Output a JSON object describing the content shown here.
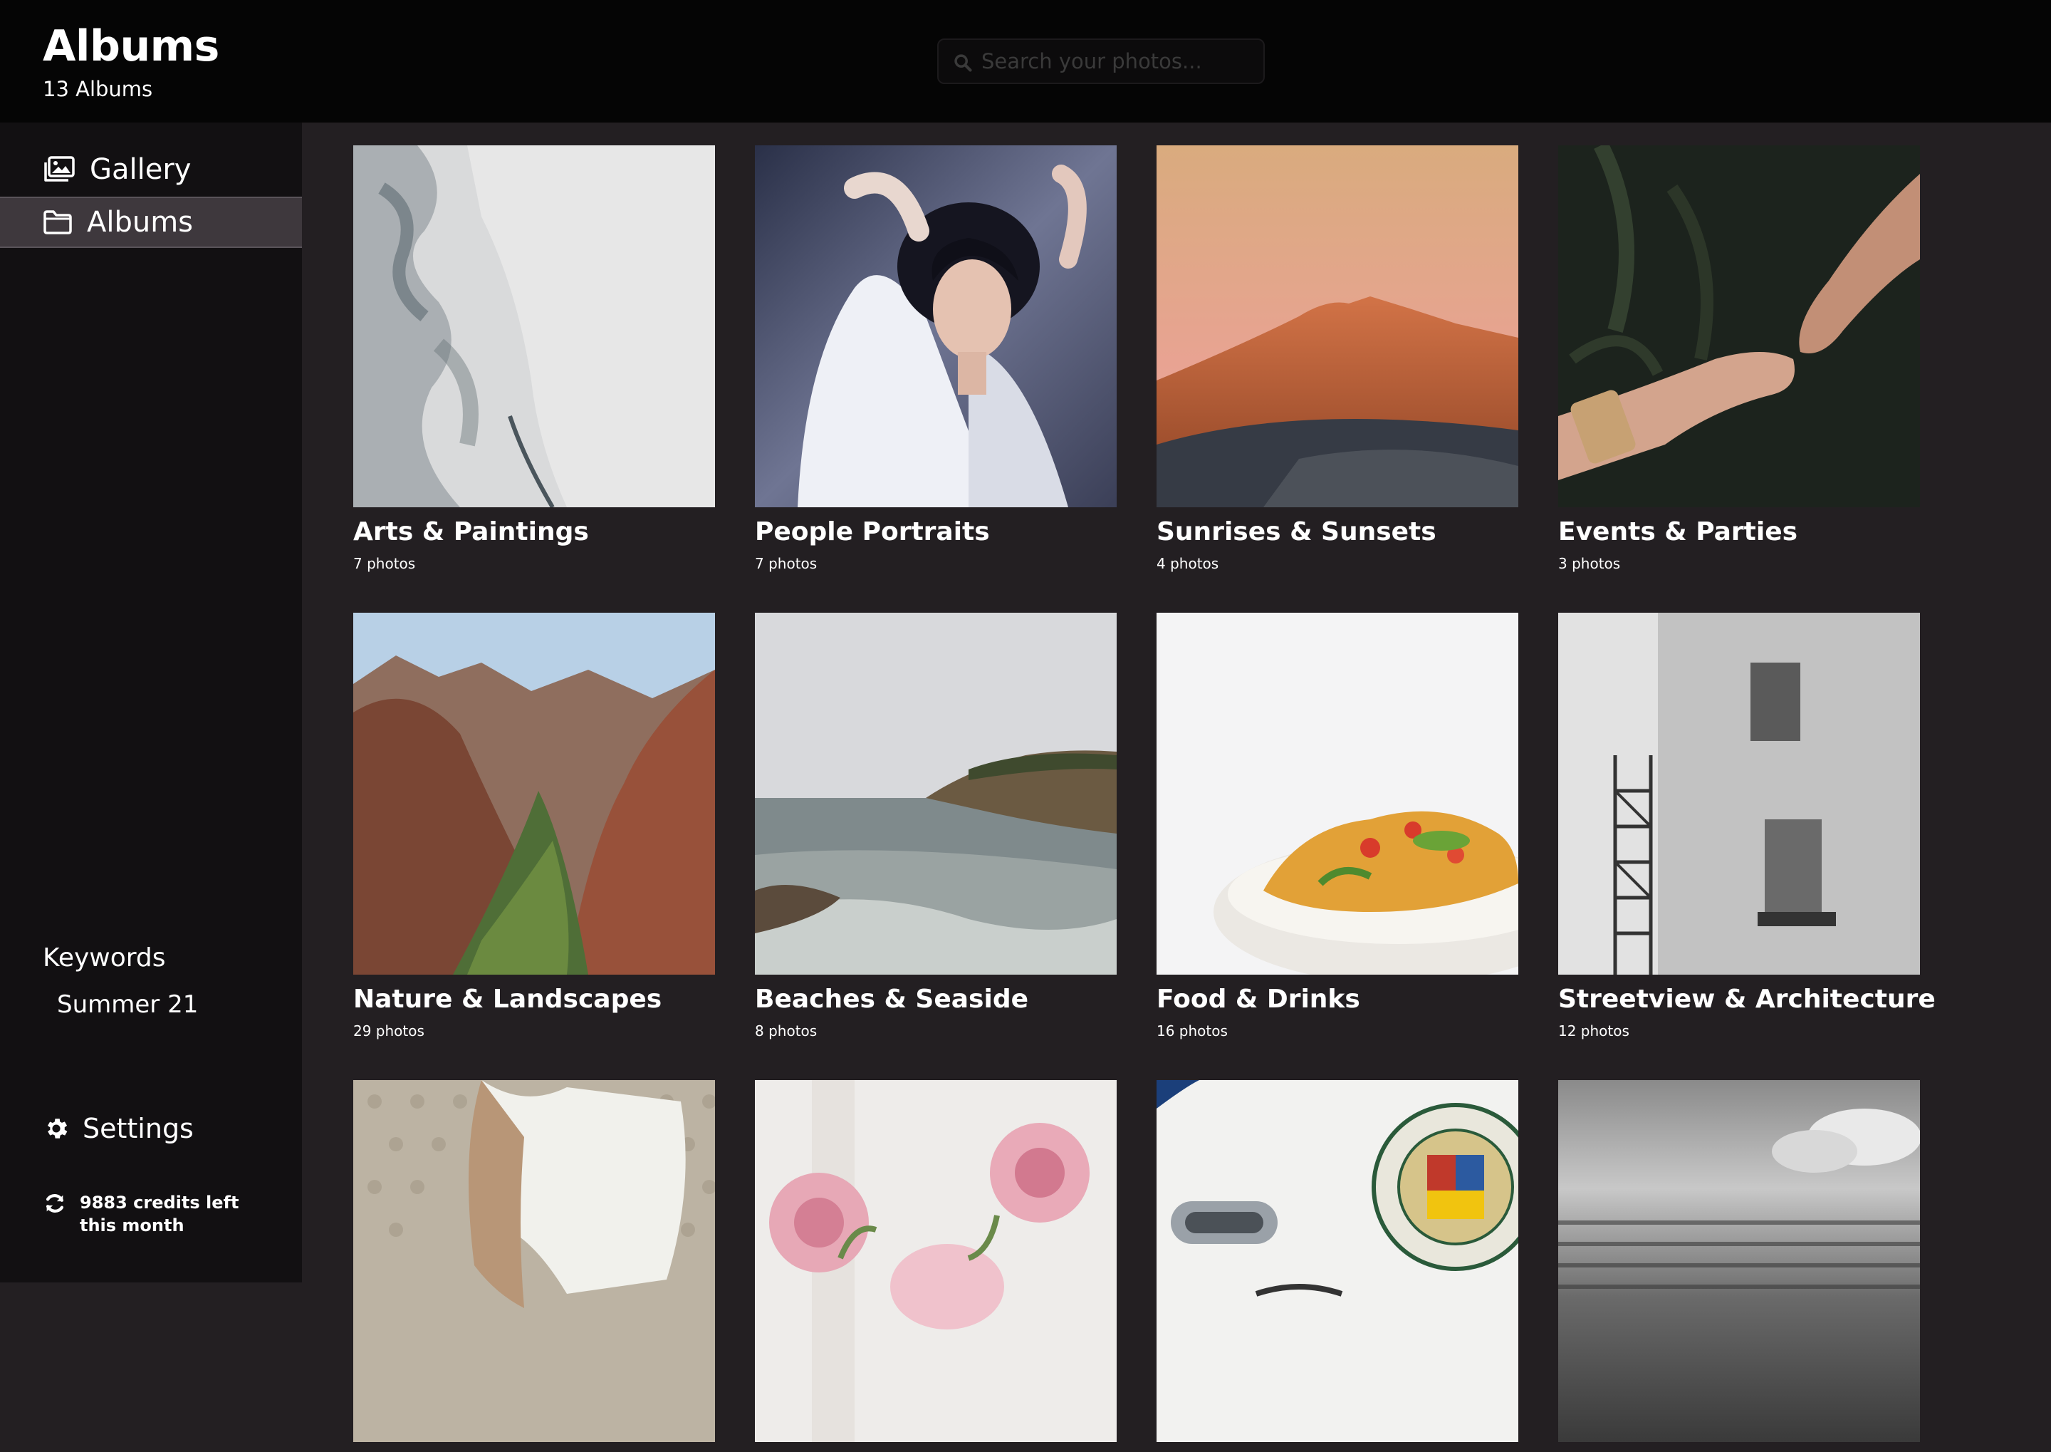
{
  "header": {
    "title": "Albums",
    "subtitle": "13 Albums",
    "search_placeholder": "Search your photos..."
  },
  "sidebar": {
    "nav": [
      {
        "label": "Gallery",
        "icon": "images-icon",
        "active": false
      },
      {
        "label": "Albums",
        "icon": "folder-icon",
        "active": true
      }
    ],
    "keywords_title": "Keywords",
    "keywords": [
      "Summer 21"
    ],
    "settings_label": "Settings",
    "credits_text": "9883 credits left this month"
  },
  "albums": [
    {
      "title": "Arts & Paintings",
      "count": "7 photos"
    },
    {
      "title": "People Portraits",
      "count": "7 photos"
    },
    {
      "title": "Sunrises & Sunsets",
      "count": "4 photos"
    },
    {
      "title": "Events & Parties",
      "count": "3 photos"
    },
    {
      "title": "Nature & Landscapes",
      "count": "29 photos"
    },
    {
      "title": "Beaches & Seaside",
      "count": "8 photos"
    },
    {
      "title": "Food & Drinks",
      "count": "16 photos"
    },
    {
      "title": "Streetview & Architecture",
      "count": "12 photos"
    },
    {
      "title": "",
      "count": ""
    },
    {
      "title": "",
      "count": ""
    },
    {
      "title": "",
      "count": ""
    },
    {
      "title": "",
      "count": ""
    }
  ],
  "colors": {
    "background": "#231f22",
    "topbar": "#050505",
    "sidebar": "#121012",
    "active_item": "#3e383d"
  }
}
